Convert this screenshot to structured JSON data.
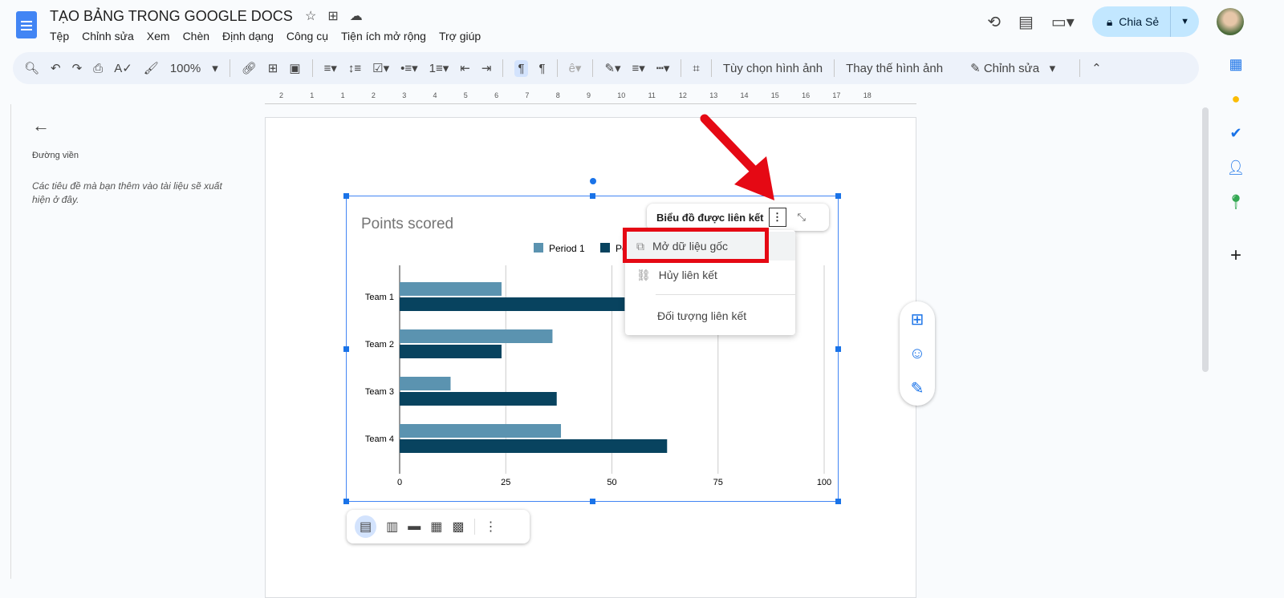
{
  "header": {
    "title": "TẠO BẢNG TRONG GOOGLE DOCS",
    "share_label": "Chia Sẻ",
    "menu": [
      "Tệp",
      "Chỉnh sửa",
      "Xem",
      "Chèn",
      "Định dạng",
      "Công cụ",
      "Tiện ích mở rộng",
      "Trợ giúp"
    ]
  },
  "toolbar": {
    "zoom": "100%",
    "image_options": "Tùy chọn hình ảnh",
    "replace_image": "Thay thế hình ảnh",
    "edit_mode": "Chỉnh sửa"
  },
  "ruler": {
    "labels": [
      "2",
      "1",
      "1",
      "2",
      "3",
      "4",
      "5",
      "6",
      "7",
      "8",
      "9",
      "10",
      "11",
      "12",
      "13",
      "14",
      "15",
      "16",
      "17",
      "18"
    ]
  },
  "sidebar": {
    "heading": "Đường viền",
    "placeholder": "Các tiêu đề mà bạn thêm vào tài liệu sẽ xuất hiện ở đây."
  },
  "linked_chart": {
    "label": "Biểu đồ được liên kết",
    "menu": [
      "Mở dữ liệu gốc",
      "Hủy liên kết",
      "Đối tượng liên kết"
    ]
  },
  "colors": {
    "period1": "#5b93b0",
    "period2": "#08435f",
    "accent": "#1a73e8",
    "highlight": "#e50914"
  },
  "chart_data": {
    "type": "bar",
    "orientation": "horizontal",
    "title": "Points scored",
    "categories": [
      "Team 1",
      "Team 2",
      "Team 3",
      "Team 4"
    ],
    "series": [
      {
        "name": "Period 1",
        "values": [
          24,
          36,
          12,
          38
        ]
      },
      {
        "name": "Period 2",
        "values": [
          53,
          24,
          37,
          63
        ]
      }
    ],
    "xlim": [
      0,
      100
    ],
    "xticks": [
      "0",
      "25",
      "50",
      "75",
      "100"
    ],
    "legend": "top",
    "grid": true
  }
}
